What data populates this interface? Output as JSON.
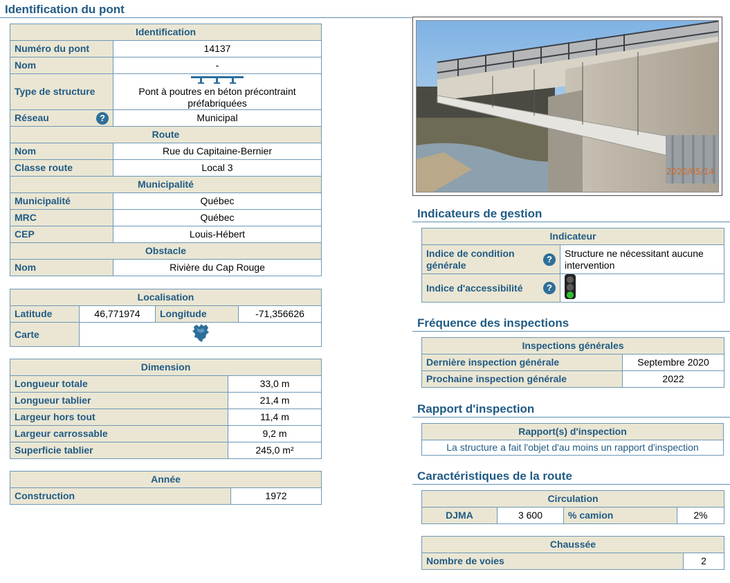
{
  "sections": {
    "identification_du_pont": "Identification du pont",
    "indicateurs_de_gestion": "Indicateurs de gestion",
    "frequence_des_inspections": "Fréquence des inspections",
    "rapport_d_inspection": "Rapport d'inspection",
    "caracteristiques_de_la_route": "Caractéristiques de la route"
  },
  "identification": {
    "header": "Identification",
    "numero_label": "Numéro du pont",
    "numero": "14137",
    "nom_label": "Nom",
    "nom": "-",
    "type_label": "Type de structure",
    "type": "Pont à poutres en béton précontraint préfabriquées",
    "reseau_label": "Réseau",
    "reseau": "Municipal",
    "route_header": "Route",
    "route_nom_label": "Nom",
    "route_nom": "Rue du Capitaine-Bernier",
    "classe_label": "Classe route",
    "classe": "Local 3",
    "municipalite_header": "Municipalité",
    "municipalite_label": "Municipalité",
    "municipalite": "Québec",
    "mrc_label": "MRC",
    "mrc": "Québec",
    "cep_label": "CEP",
    "cep": "Louis-Hébert",
    "obstacle_header": "Obstacle",
    "obstacle_nom_label": "Nom",
    "obstacle_nom": "Rivière du Cap Rouge"
  },
  "localisation": {
    "header": "Localisation",
    "latitude_label": "Latitude",
    "latitude": "46,771974",
    "longitude_label": "Longitude",
    "longitude": "-71,356626",
    "carte_label": "Carte",
    "carte_icon": "quebec-map-icon"
  },
  "dimension": {
    "header": "Dimension",
    "rows": [
      {
        "label": "Longueur totale",
        "value": "33,0 m"
      },
      {
        "label": "Longueur tablier",
        "value": "21,4 m"
      },
      {
        "label": "Largeur hors tout",
        "value": "11,4 m"
      },
      {
        "label": "Largeur carrossable",
        "value": "9,2 m"
      },
      {
        "label": "Superficie tablier",
        "value": "245,0 m²"
      }
    ]
  },
  "annee": {
    "header": "Année",
    "construction_label": "Construction",
    "construction": "1972"
  },
  "photo": {
    "date": "2020/05/14"
  },
  "indicateurs": {
    "header": "Indicateur",
    "condition_label": "Indice de condition générale",
    "condition_value": "Structure ne nécessitant aucune intervention",
    "accessibilite_label": "Indice d'accessibilité",
    "accessibilite_light": "green"
  },
  "frequence": {
    "header": "Inspections générales",
    "derniere_label": "Dernière inspection générale",
    "derniere": "Septembre 2020",
    "prochaine_label": "Prochaine inspection générale",
    "prochaine": "2022"
  },
  "rapport": {
    "header": "Rapport(s) d'inspection",
    "text": "La structure a fait l'objet d'au moins un rapport d'inspection"
  },
  "circulation": {
    "header": "Circulation",
    "djma_label": "DJMA",
    "djma": "3 600",
    "camion_label": "% camion",
    "camion": "2%"
  },
  "chaussee": {
    "header": "Chaussée",
    "voies_label": "Nombre de voies",
    "voies": "2"
  },
  "colors": {
    "title_blue": "#215b85",
    "header_bg": "#eae6d3",
    "border": "#6e98b6",
    "help_icon": "#2e6f99",
    "photo_date": "#d86a1e"
  }
}
